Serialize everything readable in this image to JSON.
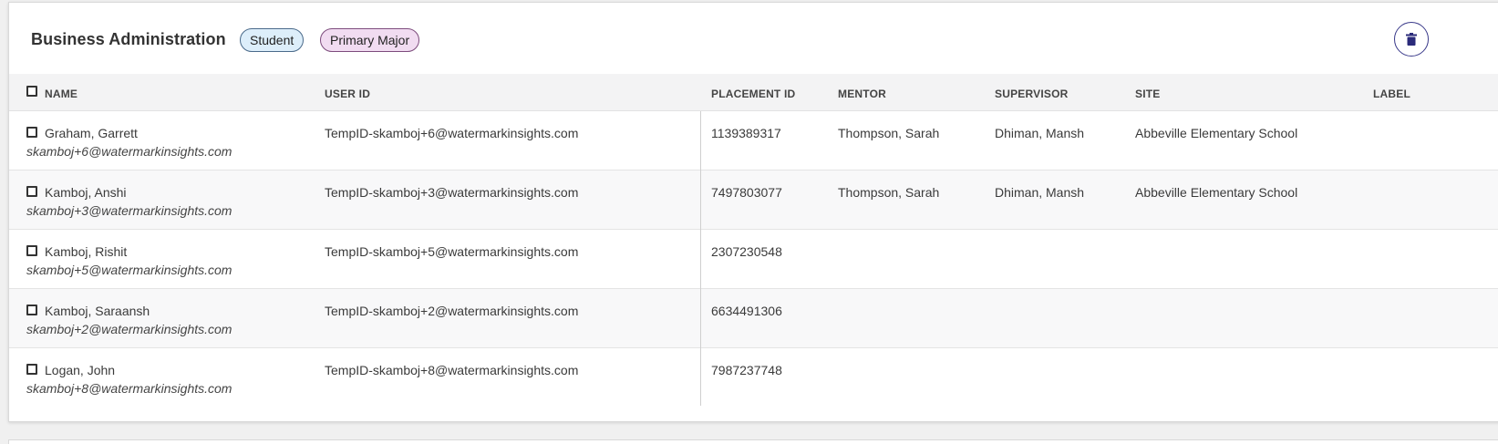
{
  "section": {
    "title": "Business Administration",
    "badges": {
      "student": "Student",
      "major": "Primary Major"
    },
    "delete_icon": "trash-icon"
  },
  "table": {
    "columns": {
      "name": "NAME",
      "user_id": "USER ID",
      "placement_id": "PLACEMENT ID",
      "mentor": "MENTOR",
      "supervisor": "SUPERVISOR",
      "site": "SITE",
      "label": "LABEL"
    },
    "rows": [
      {
        "name": "Graham, Garrett",
        "email": "skamboj+6@watermarkinsights.com",
        "user_id": "TempID-skamboj+6@watermarkinsights.com",
        "placement_id": "1139389317",
        "mentor": "Thompson, Sarah",
        "supervisor": "Dhiman, Mansh",
        "site": "Abbeville Elementary School",
        "label": ""
      },
      {
        "name": "Kamboj, Anshi",
        "email": "skamboj+3@watermarkinsights.com",
        "user_id": "TempID-skamboj+3@watermarkinsights.com",
        "placement_id": "7497803077",
        "mentor": "Thompson, Sarah",
        "supervisor": "Dhiman, Mansh",
        "site": "Abbeville Elementary School",
        "label": ""
      },
      {
        "name": "Kamboj, Rishit",
        "email": "skamboj+5@watermarkinsights.com",
        "user_id": "TempID-skamboj+5@watermarkinsights.com",
        "placement_id": "2307230548",
        "mentor": "",
        "supervisor": "",
        "site": "",
        "label": ""
      },
      {
        "name": "Kamboj, Saraansh",
        "email": "skamboj+2@watermarkinsights.com",
        "user_id": "TempID-skamboj+2@watermarkinsights.com",
        "placement_id": "6634491306",
        "mentor": "",
        "supervisor": "",
        "site": "",
        "label": ""
      },
      {
        "name": "Logan, John",
        "email": "skamboj+8@watermarkinsights.com",
        "user_id": "TempID-skamboj+8@watermarkinsights.com",
        "placement_id": "7987237748",
        "mentor": "",
        "supervisor": "",
        "site": "",
        "label": ""
      }
    ]
  },
  "colors": {
    "student_badge_bg": "#ddeefa",
    "major_badge_bg": "#f1dcf1",
    "delete_button_accent": "#3a3a8a"
  }
}
